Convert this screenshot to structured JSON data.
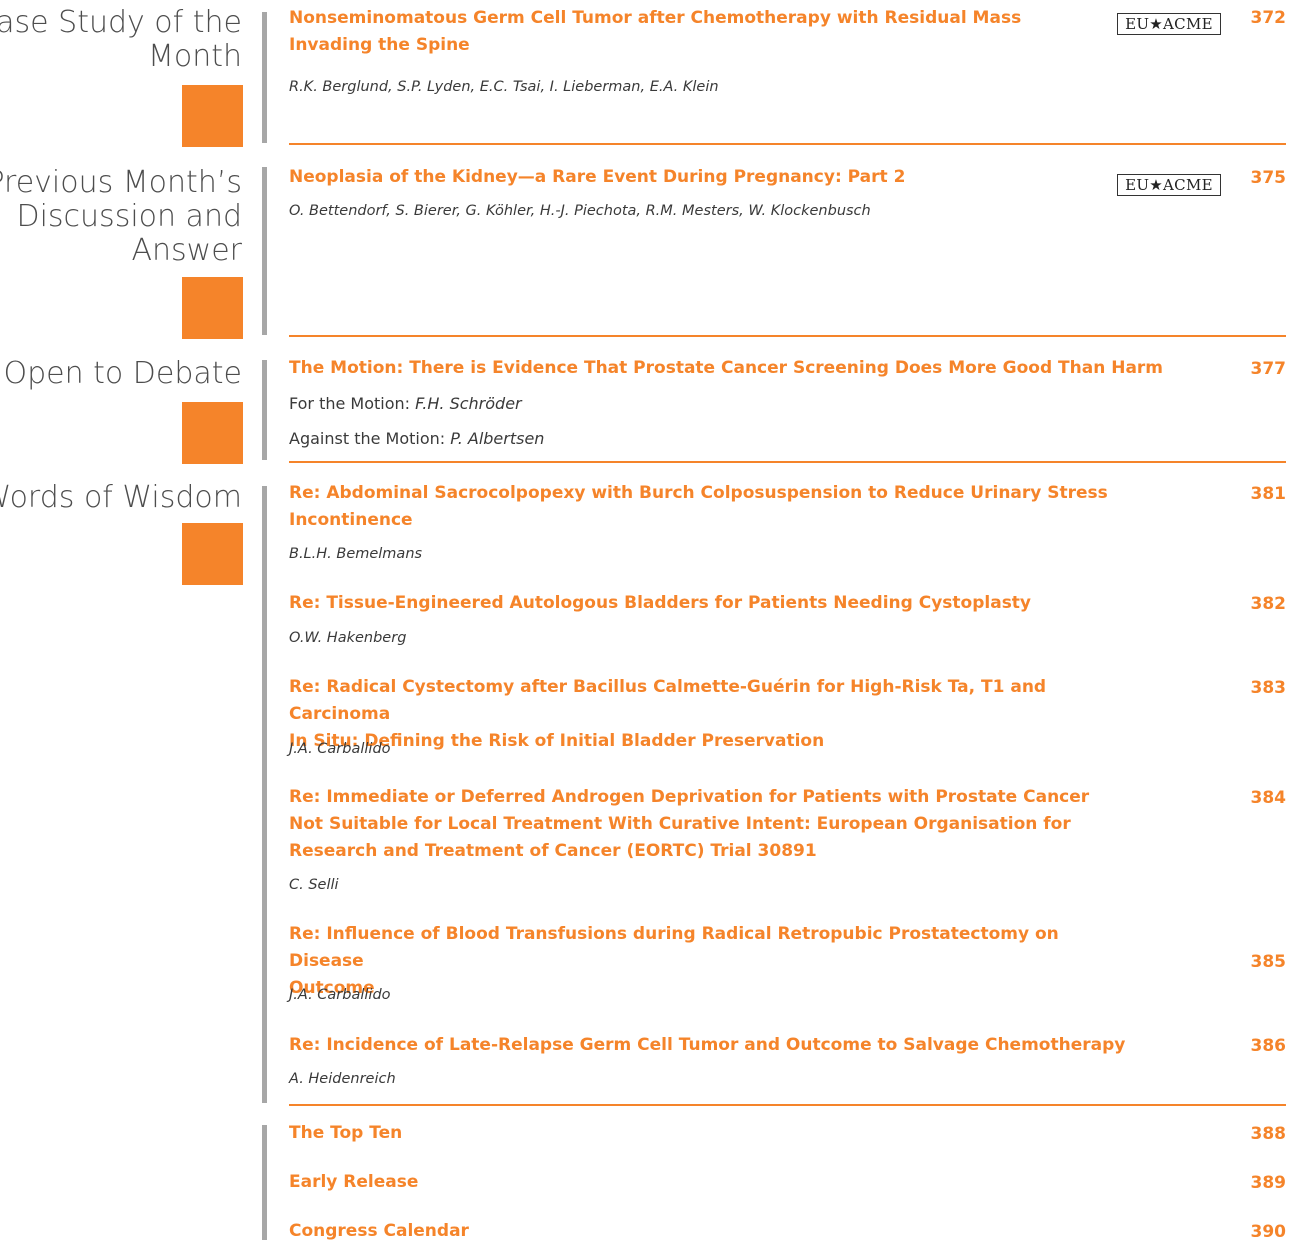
{
  "sections": {
    "case_study": {
      "title_line1": "Case Study of the",
      "title_line2": "Month",
      "article": {
        "title_line1": "Nonseminomatous Germ Cell Tumor after Chemotherapy with Residual Mass",
        "title_line2": "Invading the Spine",
        "authors": "R.K. Berglund, S.P. Lyden, E.C. Tsai, I. Lieberman, E.A. Klein",
        "page": "372",
        "badge": "EU★ACME"
      }
    },
    "previous_month": {
      "title_line1": "Previous Month’s",
      "title_line2": "Discussion and",
      "title_line3": "Answer",
      "article": {
        "title": "Neoplasia of the Kidney—a Rare Event During Pregnancy: Part 2",
        "authors": "O. Bettendorf, S. Bierer, G. Köhler, H.-J. Piechota, R.M. Mesters, W. Klockenbusch",
        "page": "375",
        "badge": "EU★ACME"
      }
    },
    "open_to_debate": {
      "title": "Open to Debate",
      "article": {
        "title": "The Motion: There is Evidence That Prostate Cancer Screening Does More Good Than Harm",
        "for_label": "For the Motion:",
        "for_name": "F.H. Schröder",
        "against_label": "Against the Motion:",
        "against_name": "P. Albertsen",
        "page": "377"
      }
    },
    "words_of_wisdom": {
      "title": "Words of Wisdom",
      "items": [
        {
          "title_line1": "Re: Abdominal Sacrocolpopexy with Burch Colposuspension to Reduce Urinary Stress",
          "title_line2": "Incontinence",
          "author": "B.L.H. Bemelmans",
          "page": "381"
        },
        {
          "title_line1": "Re: Tissue-Engineered Autologous Bladders for Patients Needing Cystoplasty",
          "author": "O.W. Hakenberg",
          "page": "382"
        },
        {
          "title_line1": "Re: Radical Cystectomy after Bacillus Calmette-Guérin for High-Risk Ta, T1 and Carcinoma",
          "title_line2": "In Situ: Defining the Risk of Initial Bladder Preservation",
          "author": "J.A. Carballido",
          "page": "383"
        },
        {
          "title_line1": "Re: Immediate or Deferred Androgen Deprivation for Patients with Prostate Cancer",
          "title_line2": "Not Suitable for Local Treatment With Curative Intent: European Organisation for",
          "title_line3": "Research and Treatment of Cancer (EORTC) Trial 30891",
          "author": "C. Selli",
          "page": "384"
        },
        {
          "title_line1": "Re: Influence of Blood Transfusions during Radical Retropubic Prostatectomy on Disease",
          "title_line2": "Outcome",
          "author": "J.A. Carballido",
          "page": "385"
        },
        {
          "title_line1": "Re: Incidence of Late-Relapse Germ Cell Tumor and Outcome to Salvage Chemotherapy",
          "author": "A. Heidenreich",
          "page": "386"
        }
      ]
    },
    "misc": [
      {
        "title": "The Top Ten",
        "page": "388"
      },
      {
        "title": "Early Release",
        "page": "389"
      },
      {
        "title": "Congress Calendar",
        "page": "390"
      }
    ]
  }
}
